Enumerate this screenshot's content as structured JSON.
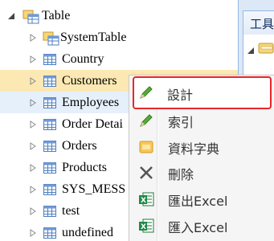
{
  "tree": {
    "root": {
      "label": "Table",
      "expanded": true
    },
    "items": [
      {
        "label": "SystemTable",
        "icon": "folder-table-icon"
      },
      {
        "label": "Country",
        "icon": "table-icon"
      },
      {
        "label": "Customers",
        "icon": "table-icon",
        "selected": true
      },
      {
        "label": "Employees",
        "icon": "table-icon",
        "hover": true
      },
      {
        "label": "Order Detai",
        "icon": "table-icon"
      },
      {
        "label": "Orders",
        "icon": "table-icon"
      },
      {
        "label": "Products",
        "icon": "table-icon"
      },
      {
        "label": "SYS_MESS",
        "icon": "table-icon"
      },
      {
        "label": "test",
        "icon": "table-icon"
      },
      {
        "label": "undefined",
        "icon": "table-icon"
      }
    ]
  },
  "right_panel": {
    "title": "工具"
  },
  "context_menu": {
    "items": [
      {
        "label": "設計",
        "icon": "pencil-icon"
      },
      {
        "label": "索引",
        "icon": "pencil-icon"
      },
      {
        "label": "資料字典",
        "icon": "dictionary-icon"
      },
      {
        "label": "刪除",
        "icon": "delete-x-icon"
      },
      {
        "label": "匯出Excel",
        "icon": "excel-export-icon"
      },
      {
        "label": "匯入Excel",
        "icon": "excel-import-icon"
      }
    ]
  },
  "colors": {
    "selected_row": "#fbe8b3",
    "hover_row": "#e6f0fb",
    "highlight_border": "#e8262a",
    "panel_border": "#95b8e7"
  }
}
